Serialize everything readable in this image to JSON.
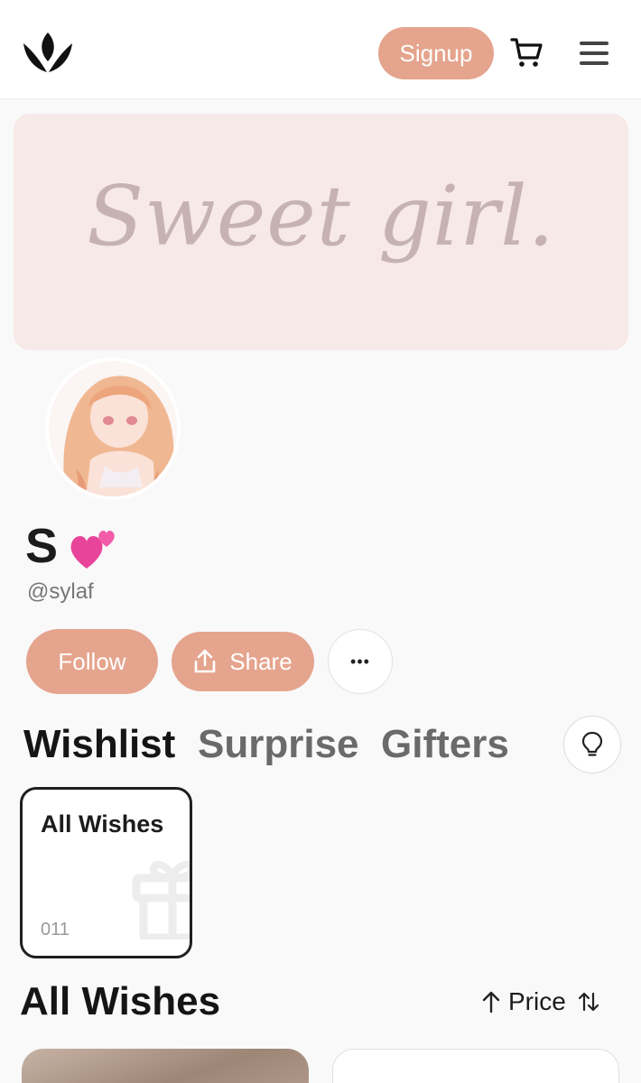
{
  "header": {
    "logo_icon": "crown-logo",
    "signup_label": "Signup",
    "cart_icon": "cart-icon",
    "menu_icon": "menu-icon",
    "accent": "#e5a48d"
  },
  "banner": {
    "text": "Sweet girl.",
    "background": "#f6e9e8"
  },
  "profile": {
    "name": "S",
    "name_emoji_icon": "two-hearts-icon",
    "handle": "@sylaf"
  },
  "actions": {
    "follow_label": "Follow",
    "share_label": "Share",
    "more_label": "•••"
  },
  "tabs": [
    {
      "label": "Wishlist",
      "active": true
    },
    {
      "label": "Surprise",
      "active": false
    },
    {
      "label": "Gifters",
      "active": false
    }
  ],
  "collection_card": {
    "title": "All Wishes",
    "count": "011",
    "icon": "gift-icon"
  },
  "section": {
    "title": "All Wishes",
    "sort_label": "Price"
  }
}
